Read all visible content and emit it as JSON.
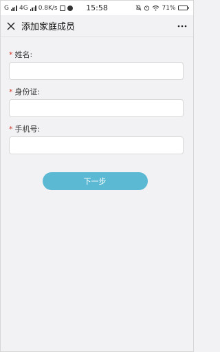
{
  "status_bar": {
    "carrier_1": "G",
    "carrier_2": "4G",
    "speed": "0.8K/s",
    "time": "15:58",
    "battery_percent": "71%",
    "battery_level": 0.71
  },
  "nav": {
    "title": "添加家庭成员",
    "icons": [
      "close-icon",
      "more-icon"
    ]
  },
  "form": {
    "required_mark": "*",
    "fields": [
      {
        "label": "姓名:",
        "value": "",
        "placeholder": ""
      },
      {
        "label": "身份证:",
        "value": "",
        "placeholder": ""
      },
      {
        "label": "手机号:",
        "value": "",
        "placeholder": ""
      }
    ],
    "next_label": "下一步"
  },
  "colors": {
    "accent": "#5cb9d4",
    "required": "#d53b2a",
    "background": "#f2f2f4"
  }
}
